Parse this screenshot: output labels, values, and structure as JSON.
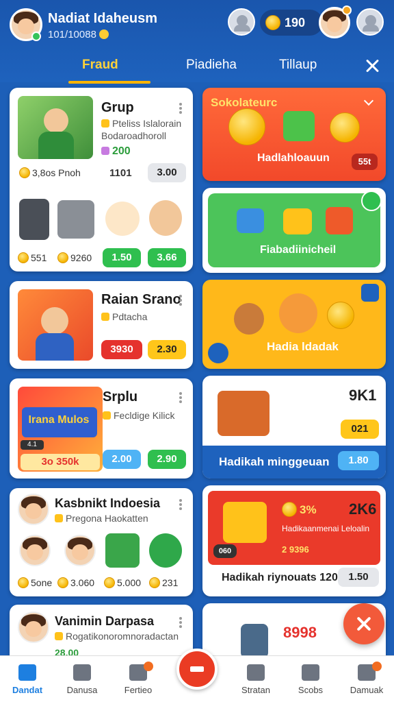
{
  "header": {
    "user_name": "Nadiat Idaheusm",
    "user_sub": "101/10088",
    "coins": "190"
  },
  "tabs": [
    {
      "label": "Fraud",
      "active": true
    },
    {
      "label": "Piadieha",
      "active": false
    },
    {
      "label": "Tillaup",
      "active": false
    }
  ],
  "left_cards": [
    {
      "title": "Grup",
      "sub1": "Pteliss Islalorain",
      "sub2": "Bodaroadhoroll",
      "gems": "200",
      "left_meta": "3,8os Pnoh",
      "count": "1101",
      "price": "3.00",
      "items_row": {
        "a": "551",
        "b": "9260",
        "btn1": "1.50",
        "btn2": "3.66"
      }
    },
    {
      "title": "Raian Srano",
      "sub": "Pdtacha",
      "btn1": "3930",
      "btn2": "2.30"
    },
    {
      "title": "Srplu",
      "sub": "Fecldige Kilick",
      "thumb_text": "Irana Mulos",
      "thumb_price": "3o 350k",
      "thumb_tag": "4.1",
      "btn1": "2.00",
      "btn2": "2.90"
    },
    {
      "title": "Kasbnikt Indoesia",
      "sub": "Pregona Haokatten",
      "stats": [
        "5one",
        "3.060",
        "5.000",
        "231"
      ]
    },
    {
      "title": "Vanimin Darpasa",
      "sub": "Rogatikonoromnoradactan",
      "val": "28.00"
    }
  ],
  "right_cards": [
    {
      "title": "Sokolateurc",
      "caption": "Hadlahloauun",
      "tag": "55t"
    },
    {
      "caption": "Fiabadiinicheil"
    },
    {
      "caption": "Hadia ldadak"
    },
    {
      "top_val": "9K1",
      "mid_val": "021",
      "caption": "Hadikah minggeuan",
      "btn": "1.80"
    },
    {
      "percent": "3%",
      "big_val": "2K6",
      "line1": "Hadikaanmenai Leloalin",
      "line2": "2 9396",
      "chip": "060",
      "caption": "Hadikah riynouats 120",
      "btn": "1.50"
    },
    {
      "big_val": "8998"
    }
  ],
  "bottom_nav": [
    {
      "label": "Dandat",
      "active": true
    },
    {
      "label": "Danusa",
      "active": false
    },
    {
      "label": "Fertieo",
      "active": false
    },
    {
      "label": "Stratan",
      "active": false
    },
    {
      "label": "Scobs",
      "active": false
    },
    {
      "label": "Damuak",
      "active": false
    }
  ]
}
